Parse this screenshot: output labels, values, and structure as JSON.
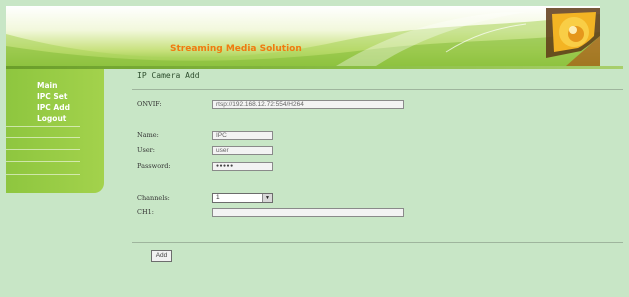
{
  "banner": {
    "title": "Streaming Media Solution"
  },
  "sidebar": {
    "items": [
      {
        "label": "Main"
      },
      {
        "label": "IPC Set"
      },
      {
        "label": "IPC Add"
      },
      {
        "label": "Logout"
      }
    ]
  },
  "page": {
    "title": "IP Camera Add"
  },
  "form": {
    "onvif": {
      "label": "ONVIF:",
      "value": "rtsp://192.168.12.72:554/H264"
    },
    "name": {
      "label": "Name:",
      "value": "IPC"
    },
    "user": {
      "label": "User:",
      "value": "user"
    },
    "password": {
      "label": "Password:",
      "value": "●●●●●"
    },
    "channels": {
      "label": "Channels:",
      "value": "1"
    },
    "ch1": {
      "label": "CH1:",
      "value": ""
    },
    "add_label": "Add"
  },
  "colors": {
    "background": "#c8e6c6",
    "sidebar": "#9acd45",
    "banner_title": "#f07a10"
  }
}
